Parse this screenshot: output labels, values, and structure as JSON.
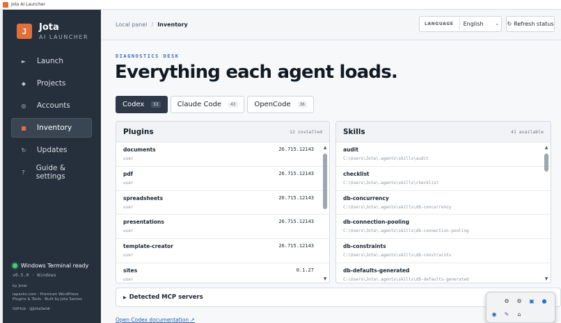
{
  "window": {
    "title": "Jota AI Launcher"
  },
  "brand": {
    "logo": "J",
    "name": "Jota",
    "subtitle": "AI LAUNCHER"
  },
  "sidebar": {
    "items": [
      {
        "icon": "►",
        "label": "Launch"
      },
      {
        "icon": "◆",
        "label": "Projects"
      },
      {
        "icon": "◎",
        "label": "Accounts"
      },
      {
        "icon": "■",
        "label": "Inventory"
      },
      {
        "icon": "↻",
        "label": "Updates"
      },
      {
        "icon": "?",
        "label": "Guide & settings"
      }
    ],
    "status": "Windows Terminal ready",
    "version": "v0.5.0 · Windows",
    "byline": "by Jotal",
    "promo": "iapacks.com - Premium WordPress Plugins & Tools · Built by Jota Santos",
    "github": "GitHub · @JotaSeldi"
  },
  "header": {
    "breadcrumb_root": "Local panel",
    "breadcrumb_sep": "/",
    "breadcrumb_current": "Inventory",
    "language_label": "LANGUAGE",
    "language_value": "English",
    "refresh_label": "Refresh status"
  },
  "main": {
    "eyebrow": "DIAGNOSTICS DESK",
    "headline": "Everything each agent loads.",
    "tabs": [
      {
        "label": "Codex",
        "count": "53"
      },
      {
        "label": "Claude Code",
        "count": "43"
      },
      {
        "label": "OpenCode",
        "count": "36"
      }
    ]
  },
  "plugins": {
    "title": "Plugins",
    "count": "12 installed",
    "rows": [
      {
        "name": "documents",
        "sub": "user",
        "version": "26.715.12143"
      },
      {
        "name": "pdf",
        "sub": "user",
        "version": "26.715.12143"
      },
      {
        "name": "spreadsheets",
        "sub": "user",
        "version": "26.715.12143"
      },
      {
        "name": "presentations",
        "sub": "user",
        "version": "26.715.12143"
      },
      {
        "name": "template-creator",
        "sub": "user",
        "version": "26.715.12143"
      },
      {
        "name": "sites",
        "sub": "user",
        "version": "0.1.27"
      }
    ]
  },
  "skills": {
    "title": "Skills",
    "count": "41 available",
    "rows": [
      {
        "name": "audit",
        "sub": "C:\\Users\\Jota\\.agents\\skills\\audit"
      },
      {
        "name": "checklist",
        "sub": "C:\\Users\\Jota\\.agents\\skills\\checklist"
      },
      {
        "name": "db-concurrency",
        "sub": "C:\\Users\\Jota\\.agents\\skills\\db-concurrency"
      },
      {
        "name": "db-connection-pooling",
        "sub": "C:\\Users\\Jota\\.agents\\skills\\db-connection-pooling"
      },
      {
        "name": "db-constraints",
        "sub": "C:\\Users\\Jota\\.agents\\skills\\db-constraints"
      },
      {
        "name": "db-defaults-generated",
        "sub": "C:\\Users\\Jota\\.agents\\skills\\db-defaults-generated"
      }
    ]
  },
  "mcp": {
    "label": "Detected MCP servers"
  },
  "docs": {
    "link": "Open Codex documentation ↗"
  },
  "colors": {
    "accent": "#e0703a",
    "sidebar": "#26303c",
    "status_ok": "#3fd07a",
    "link": "#2a5fa8"
  }
}
